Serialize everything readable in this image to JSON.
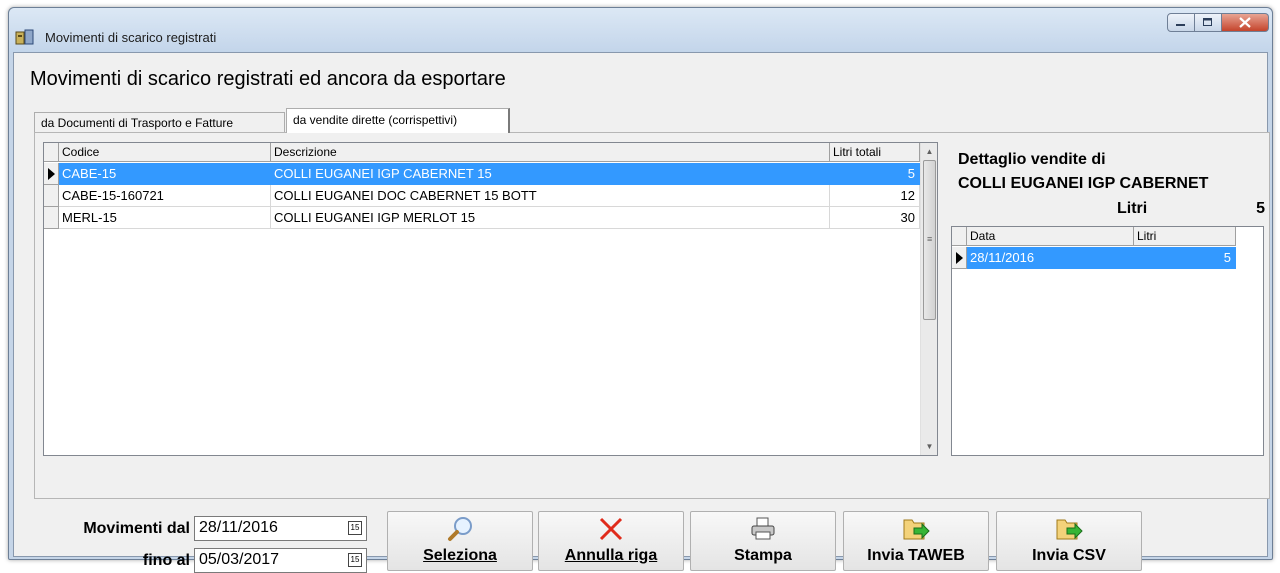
{
  "window": {
    "title": "Movimenti di scarico registrati"
  },
  "header": {
    "title": "Movimenti di scarico registrati ed ancora da esportare"
  },
  "tabs": [
    {
      "label": "da Documenti di Trasporto e Fatture"
    },
    {
      "label": "da vendite dirette (corrispettivi)"
    }
  ],
  "main_grid": {
    "columns": [
      "Codice",
      "Descrizione",
      "Litri totali"
    ],
    "rows": [
      {
        "codice": "CABE-15",
        "descrizione": "COLLI EUGANEI IGP CABERNET 15",
        "litri": "5"
      },
      {
        "codice": "CABE-15-160721",
        "descrizione": "COLLI EUGANEI DOC CABERNET 15 BOTT",
        "litri": "12"
      },
      {
        "codice": "MERL-15",
        "descrizione": "COLLI EUGANEI IGP MERLOT 15",
        "litri": "30"
      }
    ]
  },
  "detail": {
    "title_line1": "Dettaglio vendite di",
    "title_line2": "COLLI EUGANEI IGP CABERNET",
    "litri_label": "Litri",
    "litri_value": "5",
    "columns": [
      "Data",
      "Litri"
    ],
    "rows": [
      {
        "data": "28/11/2016",
        "litri": "5"
      }
    ]
  },
  "filters": {
    "dal_label": "Movimenti dal",
    "dal_value": "28/11/2016",
    "al_label": "fino al",
    "al_value": "05/03/2017"
  },
  "buttons": {
    "seleziona": "Seleziona",
    "annulla": "Annulla riga",
    "stampa": "Stampa",
    "invia_taweb": "Invia TAWEB",
    "invia_csv": "Invia CSV"
  },
  "icons": {
    "app": "app-icon",
    "minimize": "minimize-icon",
    "maximize": "maximize-icon",
    "close": "close-icon",
    "search": "magnifier-icon",
    "delete": "red-x-icon",
    "print": "printer-icon",
    "export": "export-icon",
    "calendar": "calendar-icon"
  }
}
